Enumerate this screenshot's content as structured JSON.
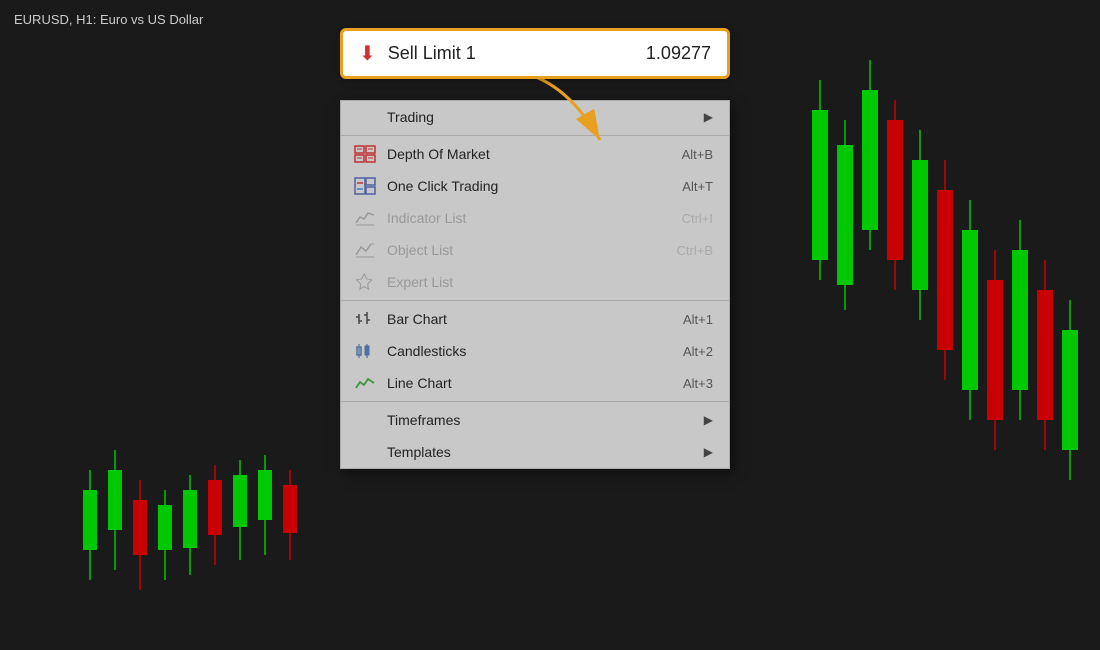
{
  "chart": {
    "title": "EURUSD, H1:  Euro vs US Dollar"
  },
  "sellLimitBox": {
    "icon": "▼",
    "label": "Sell Limit 1",
    "price": "1.09277"
  },
  "contextMenu": {
    "items": [
      {
        "id": "trading",
        "label": "Trading",
        "icon": "",
        "shortcut": "",
        "hasArrow": true,
        "disabled": false,
        "separator_before": false
      },
      {
        "id": "separator1",
        "type": "separator"
      },
      {
        "id": "depth-of-market",
        "label": "Depth Of Market",
        "icon": "dom",
        "shortcut": "Alt+B",
        "hasArrow": false,
        "disabled": false
      },
      {
        "id": "one-click-trading",
        "label": "One Click Trading",
        "icon": "oct",
        "shortcut": "Alt+T",
        "hasArrow": false,
        "disabled": false
      },
      {
        "id": "indicator-list",
        "label": "Indicator List",
        "icon": "indicator",
        "shortcut": "Ctrl+I",
        "hasArrow": false,
        "disabled": true
      },
      {
        "id": "object-list",
        "label": "Object List",
        "icon": "object",
        "shortcut": "Ctrl+B",
        "hasArrow": false,
        "disabled": true
      },
      {
        "id": "expert-list",
        "label": "Expert List",
        "icon": "expert",
        "shortcut": "",
        "hasArrow": false,
        "disabled": true
      },
      {
        "id": "separator2",
        "type": "separator"
      },
      {
        "id": "bar-chart",
        "label": "Bar Chart",
        "icon": "bar",
        "shortcut": "Alt+1",
        "hasArrow": false,
        "disabled": false
      },
      {
        "id": "candlesticks",
        "label": "Candlesticks",
        "icon": "candle",
        "shortcut": "Alt+2",
        "hasArrow": false,
        "disabled": false
      },
      {
        "id": "line-chart",
        "label": "Line Chart",
        "icon": "line",
        "shortcut": "Alt+3",
        "hasArrow": false,
        "disabled": false
      },
      {
        "id": "separator3",
        "type": "separator"
      },
      {
        "id": "timeframes",
        "label": "Timeframes",
        "icon": "",
        "shortcut": "",
        "hasArrow": true,
        "disabled": false
      },
      {
        "id": "templates",
        "label": "Templates",
        "icon": "",
        "shortcut": "",
        "hasArrow": true,
        "disabled": false
      }
    ]
  }
}
